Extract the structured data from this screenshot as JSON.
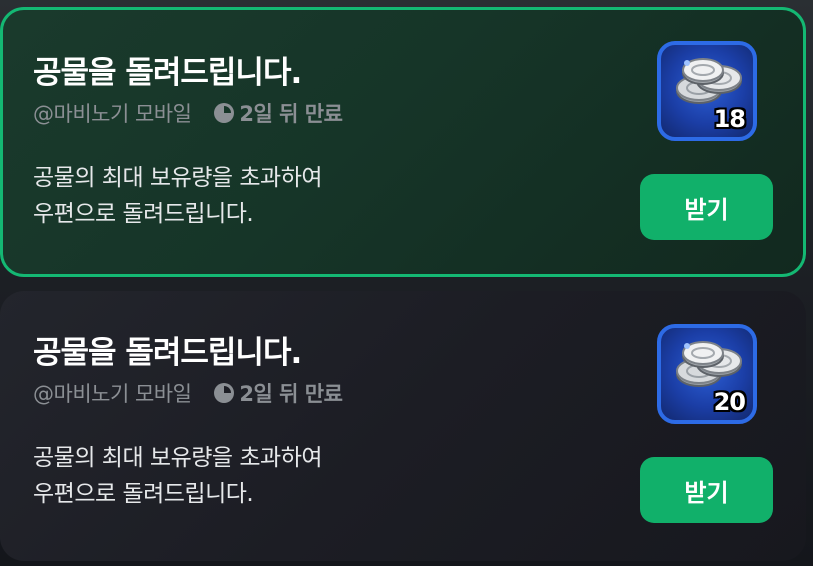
{
  "mails": [
    {
      "title": "공물을 돌려드립니다.",
      "sender": "@마비노기 모바일",
      "expiry": "2일 뒤 만료",
      "body_lines": [
        "공물의 최대 보유량을 초과하여",
        "우편으로 돌려드립니다."
      ],
      "reward": {
        "icon": "silver-coins-icon",
        "count": "18"
      },
      "claim_label": "받기",
      "selected": true
    },
    {
      "title": "공물을 돌려드립니다.",
      "sender": "@마비노기 모바일",
      "expiry": "2일 뒤 만료",
      "body_lines": [
        "공물의 최대 보유량을 초과하여",
        "우편으로 돌려드립니다."
      ],
      "reward": {
        "icon": "silver-coins-icon",
        "count": "20"
      },
      "claim_label": "받기",
      "selected": false
    }
  ],
  "colors": {
    "accent": "#11b06a",
    "selected_border": "#14b873",
    "reward_frame": "#2d6be6",
    "muted_text": "#8b8f94"
  }
}
